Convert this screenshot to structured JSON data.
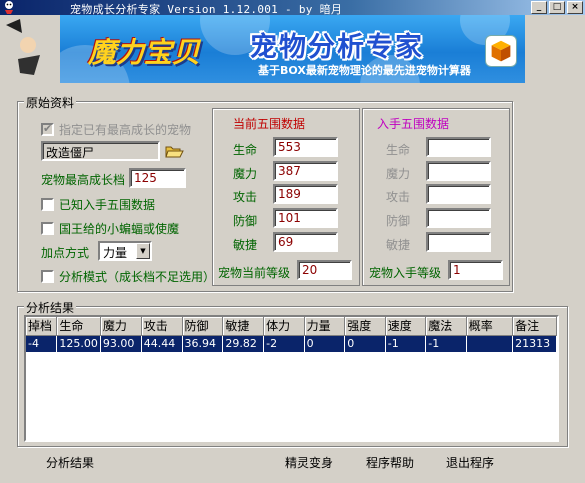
{
  "window": {
    "title": "宠物成长分析专家 Version 1.12.001 - by 暗月",
    "min_label": "_",
    "max_label": "□",
    "close_label": "×"
  },
  "banner": {
    "logo": "魔力宝贝",
    "title": "宠物分析专家",
    "tagline": "基于BOX最新宠物理论的最先进宠物计算器"
  },
  "raw": {
    "caption": "原始资料",
    "specify_highest": "指定已有最高成长的宠物",
    "pet_name": "改造僵尸",
    "max_growth_label": "宠物最高成长档",
    "max_growth_value": "125",
    "known_stats_label": "已知入手五围数据",
    "king_bat_label": "国王给的小蝙蝠或使魔",
    "points_label": "加点方式",
    "points_value": "力量",
    "analysis_mode_label": "分析模式（成长档不足选用）"
  },
  "current": {
    "caption": "当前五围数据",
    "stats": [
      {
        "label": "生命",
        "value": "553"
      },
      {
        "label": "魔力",
        "value": "387"
      },
      {
        "label": "攻击",
        "value": "189"
      },
      {
        "label": "防御",
        "value": "101"
      },
      {
        "label": "敏捷",
        "value": "69"
      }
    ],
    "level_label": "宠物当前等级",
    "level_value": "20"
  },
  "initial": {
    "caption": "入手五围数据",
    "stats": [
      {
        "label": "生命",
        "value": ""
      },
      {
        "label": "魔力",
        "value": ""
      },
      {
        "label": "攻击",
        "value": ""
      },
      {
        "label": "防御",
        "value": ""
      },
      {
        "label": "敏捷",
        "value": ""
      }
    ],
    "level_label": "宠物入手等级",
    "level_value": "1"
  },
  "results": {
    "caption": "分析结果",
    "columns": [
      "掉档",
      "生命",
      "魔力",
      "攻击",
      "防御",
      "敏捷",
      "体力",
      "力量",
      "强度",
      "速度",
      "魔法",
      "概率",
      "备注"
    ],
    "rows": [
      [
        "-4",
        "125.00",
        "93.00",
        "44.44",
        "36.94",
        "29.82",
        "-2",
        "0",
        "0",
        "-1",
        "-1",
        "",
        "21313"
      ]
    ]
  },
  "bottom": {
    "analyze": "分析结果",
    "sprite": "精灵变身",
    "help": "程序帮助",
    "exit": "退出程序"
  },
  "colors": {
    "titlebar": "#0a246a",
    "selection": "#0a246a",
    "label_green": "#006400",
    "caption_red": "#c00000",
    "caption_magenta": "#c000c0",
    "value_red": "#8b0000"
  }
}
